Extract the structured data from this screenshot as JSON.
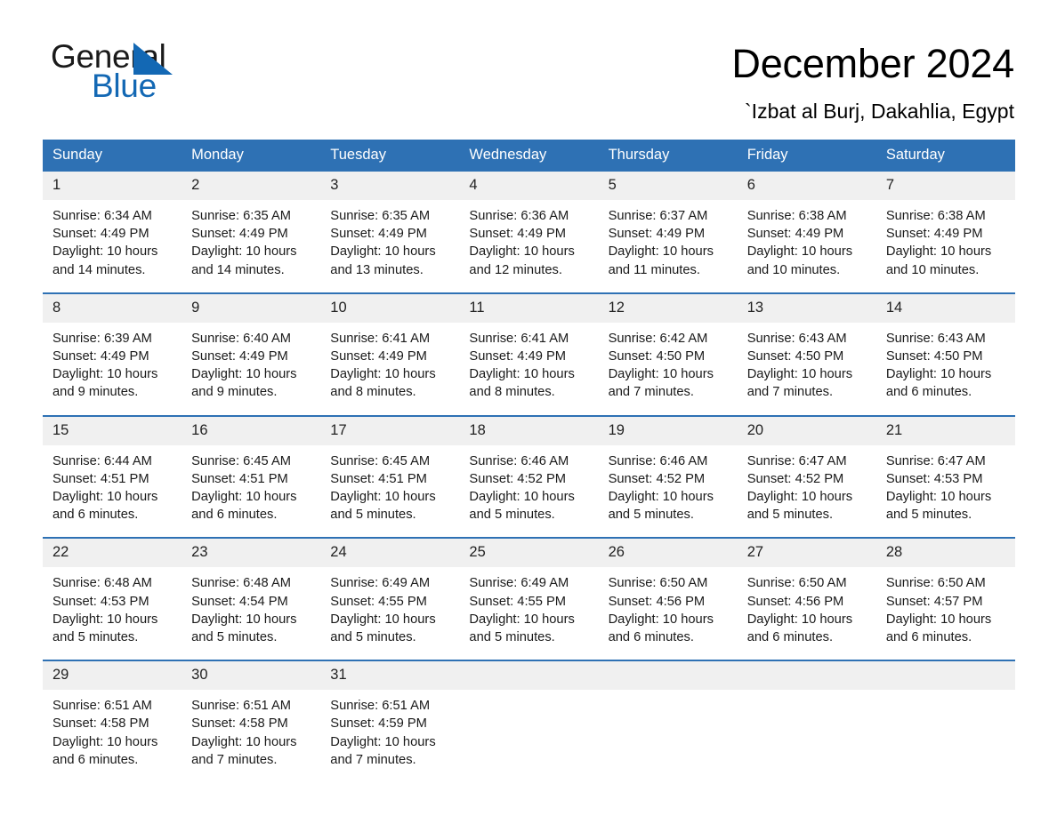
{
  "brand": {
    "name_part1": "General",
    "name_part2": "Blue",
    "accent_color": "#1368b4"
  },
  "header": {
    "title": "December 2024",
    "subtitle": "`Izbat al Burj, Dakahlia, Egypt"
  },
  "theme": {
    "header_blue": "#2e71b4",
    "date_band": "#f0f0f0",
    "text": "#1a1a1a"
  },
  "weekdays": [
    "Sunday",
    "Monday",
    "Tuesday",
    "Wednesday",
    "Thursday",
    "Friday",
    "Saturday"
  ],
  "weeks": [
    [
      {
        "date": "1",
        "sunrise": "Sunrise: 6:34 AM",
        "sunset": "Sunset: 4:49 PM",
        "daylight": "Daylight: 10 hours and 14 minutes."
      },
      {
        "date": "2",
        "sunrise": "Sunrise: 6:35 AM",
        "sunset": "Sunset: 4:49 PM",
        "daylight": "Daylight: 10 hours and 14 minutes."
      },
      {
        "date": "3",
        "sunrise": "Sunrise: 6:35 AM",
        "sunset": "Sunset: 4:49 PM",
        "daylight": "Daylight: 10 hours and 13 minutes."
      },
      {
        "date": "4",
        "sunrise": "Sunrise: 6:36 AM",
        "sunset": "Sunset: 4:49 PM",
        "daylight": "Daylight: 10 hours and 12 minutes."
      },
      {
        "date": "5",
        "sunrise": "Sunrise: 6:37 AM",
        "sunset": "Sunset: 4:49 PM",
        "daylight": "Daylight: 10 hours and 11 minutes."
      },
      {
        "date": "6",
        "sunrise": "Sunrise: 6:38 AM",
        "sunset": "Sunset: 4:49 PM",
        "daylight": "Daylight: 10 hours and 10 minutes."
      },
      {
        "date": "7",
        "sunrise": "Sunrise: 6:38 AM",
        "sunset": "Sunset: 4:49 PM",
        "daylight": "Daylight: 10 hours and 10 minutes."
      }
    ],
    [
      {
        "date": "8",
        "sunrise": "Sunrise: 6:39 AM",
        "sunset": "Sunset: 4:49 PM",
        "daylight": "Daylight: 10 hours and 9 minutes."
      },
      {
        "date": "9",
        "sunrise": "Sunrise: 6:40 AM",
        "sunset": "Sunset: 4:49 PM",
        "daylight": "Daylight: 10 hours and 9 minutes."
      },
      {
        "date": "10",
        "sunrise": "Sunrise: 6:41 AM",
        "sunset": "Sunset: 4:49 PM",
        "daylight": "Daylight: 10 hours and 8 minutes."
      },
      {
        "date": "11",
        "sunrise": "Sunrise: 6:41 AM",
        "sunset": "Sunset: 4:49 PM",
        "daylight": "Daylight: 10 hours and 8 minutes."
      },
      {
        "date": "12",
        "sunrise": "Sunrise: 6:42 AM",
        "sunset": "Sunset: 4:50 PM",
        "daylight": "Daylight: 10 hours and 7 minutes."
      },
      {
        "date": "13",
        "sunrise": "Sunrise: 6:43 AM",
        "sunset": "Sunset: 4:50 PM",
        "daylight": "Daylight: 10 hours and 7 minutes."
      },
      {
        "date": "14",
        "sunrise": "Sunrise: 6:43 AM",
        "sunset": "Sunset: 4:50 PM",
        "daylight": "Daylight: 10 hours and 6 minutes."
      }
    ],
    [
      {
        "date": "15",
        "sunrise": "Sunrise: 6:44 AM",
        "sunset": "Sunset: 4:51 PM",
        "daylight": "Daylight: 10 hours and 6 minutes."
      },
      {
        "date": "16",
        "sunrise": "Sunrise: 6:45 AM",
        "sunset": "Sunset: 4:51 PM",
        "daylight": "Daylight: 10 hours and 6 minutes."
      },
      {
        "date": "17",
        "sunrise": "Sunrise: 6:45 AM",
        "sunset": "Sunset: 4:51 PM",
        "daylight": "Daylight: 10 hours and 5 minutes."
      },
      {
        "date": "18",
        "sunrise": "Sunrise: 6:46 AM",
        "sunset": "Sunset: 4:52 PM",
        "daylight": "Daylight: 10 hours and 5 minutes."
      },
      {
        "date": "19",
        "sunrise": "Sunrise: 6:46 AM",
        "sunset": "Sunset: 4:52 PM",
        "daylight": "Daylight: 10 hours and 5 minutes."
      },
      {
        "date": "20",
        "sunrise": "Sunrise: 6:47 AM",
        "sunset": "Sunset: 4:52 PM",
        "daylight": "Daylight: 10 hours and 5 minutes."
      },
      {
        "date": "21",
        "sunrise": "Sunrise: 6:47 AM",
        "sunset": "Sunset: 4:53 PM",
        "daylight": "Daylight: 10 hours and 5 minutes."
      }
    ],
    [
      {
        "date": "22",
        "sunrise": "Sunrise: 6:48 AM",
        "sunset": "Sunset: 4:53 PM",
        "daylight": "Daylight: 10 hours and 5 minutes."
      },
      {
        "date": "23",
        "sunrise": "Sunrise: 6:48 AM",
        "sunset": "Sunset: 4:54 PM",
        "daylight": "Daylight: 10 hours and 5 minutes."
      },
      {
        "date": "24",
        "sunrise": "Sunrise: 6:49 AM",
        "sunset": "Sunset: 4:55 PM",
        "daylight": "Daylight: 10 hours and 5 minutes."
      },
      {
        "date": "25",
        "sunrise": "Sunrise: 6:49 AM",
        "sunset": "Sunset: 4:55 PM",
        "daylight": "Daylight: 10 hours and 5 minutes."
      },
      {
        "date": "26",
        "sunrise": "Sunrise: 6:50 AM",
        "sunset": "Sunset: 4:56 PM",
        "daylight": "Daylight: 10 hours and 6 minutes."
      },
      {
        "date": "27",
        "sunrise": "Sunrise: 6:50 AM",
        "sunset": "Sunset: 4:56 PM",
        "daylight": "Daylight: 10 hours and 6 minutes."
      },
      {
        "date": "28",
        "sunrise": "Sunrise: 6:50 AM",
        "sunset": "Sunset: 4:57 PM",
        "daylight": "Daylight: 10 hours and 6 minutes."
      }
    ],
    [
      {
        "date": "29",
        "sunrise": "Sunrise: 6:51 AM",
        "sunset": "Sunset: 4:58 PM",
        "daylight": "Daylight: 10 hours and 6 minutes."
      },
      {
        "date": "30",
        "sunrise": "Sunrise: 6:51 AM",
        "sunset": "Sunset: 4:58 PM",
        "daylight": "Daylight: 10 hours and 7 minutes."
      },
      {
        "date": "31",
        "sunrise": "Sunrise: 6:51 AM",
        "sunset": "Sunset: 4:59 PM",
        "daylight": "Daylight: 10 hours and 7 minutes."
      },
      {
        "date": "",
        "sunrise": "",
        "sunset": "",
        "daylight": ""
      },
      {
        "date": "",
        "sunrise": "",
        "sunset": "",
        "daylight": ""
      },
      {
        "date": "",
        "sunrise": "",
        "sunset": "",
        "daylight": ""
      },
      {
        "date": "",
        "sunrise": "",
        "sunset": "",
        "daylight": ""
      }
    ]
  ]
}
